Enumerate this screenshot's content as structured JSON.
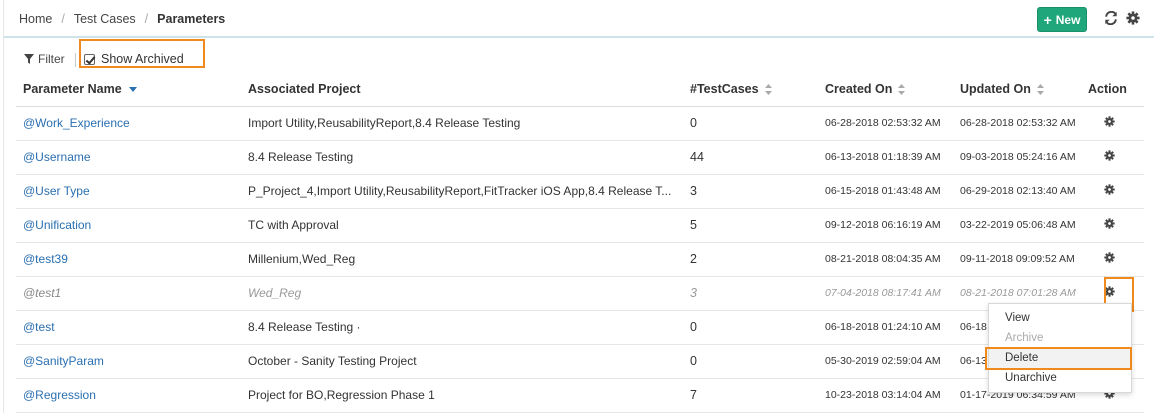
{
  "breadcrumb": {
    "home": "Home",
    "test_cases": "Test Cases",
    "current": "Parameters"
  },
  "toolbar": {
    "new_label": "New",
    "icons": [
      "refresh-icon",
      "settings-icon"
    ]
  },
  "filterbar": {
    "filter_label": "Filter",
    "show_archived_label": "Show Archived",
    "show_archived_checked": true
  },
  "table": {
    "columns": [
      "Parameter Name",
      "Associated Project",
      "#TestCases",
      "Created On",
      "Updated On",
      "Action"
    ],
    "rows": [
      {
        "name": "@Work_Experience",
        "project": "Import Utility,ReusabilityReport,8.4 Release Testing",
        "testcases": "0",
        "created": "06-28-2018 02:53:32 AM",
        "updated": "06-28-2018 02:53:32 AM",
        "archived": false
      },
      {
        "name": "@Username",
        "project": "8.4 Release Testing",
        "testcases": "44",
        "created": "06-13-2018 01:18:39 AM",
        "updated": "09-03-2018 05:24:16 AM",
        "archived": false
      },
      {
        "name": "@User Type",
        "project": "P_Project_4,Import Utility,ReusabilityReport,FitTracker iOS App,8.4 Release T...",
        "testcases": "3",
        "created": "06-15-2018 01:43:48 AM",
        "updated": "06-29-2018 02:13:40 AM",
        "archived": false
      },
      {
        "name": "@Unification",
        "project": "TC with Approval",
        "testcases": "5",
        "created": "09-12-2018 06:16:19 AM",
        "updated": "03-22-2019 05:06:48 AM",
        "archived": false
      },
      {
        "name": "@test39",
        "project": "Millenium,Wed_Reg",
        "testcases": "2",
        "created": "08-21-2018 08:04:35 AM",
        "updated": "09-11-2018 09:09:52 AM",
        "archived": false
      },
      {
        "name": "@test1",
        "project": "Wed_Reg",
        "testcases": "3",
        "created": "07-04-2018 08:17:41 AM",
        "updated": "08-21-2018 07:01:28 AM",
        "archived": true
      },
      {
        "name": "@test",
        "project": "8.4 Release Testing ·",
        "testcases": "0",
        "created": "06-18-2018 01:24:10 AM",
        "updated": "06-18",
        "archived": false
      },
      {
        "name": "@SanityParam",
        "project": "October - Sanity Testing Project",
        "testcases": "0",
        "created": "05-30-2019 02:59:04 AM",
        "updated": "06-13",
        "archived": false
      },
      {
        "name": "@Regression",
        "project": "Project for BO,Regression Phase 1",
        "testcases": "7",
        "created": "10-23-2018 03:14:04 AM",
        "updated": "01-17-2019 06:34:59 AM",
        "archived": false
      }
    ]
  },
  "action_menu": {
    "items": [
      "View",
      "Archive",
      "Delete",
      "Unarchive"
    ],
    "disabled": [
      "Archive"
    ],
    "highlighted": "Delete"
  },
  "colors": {
    "accent": "#1fa67a",
    "link": "#2a6fb0",
    "highlight": "#f08a1c"
  }
}
